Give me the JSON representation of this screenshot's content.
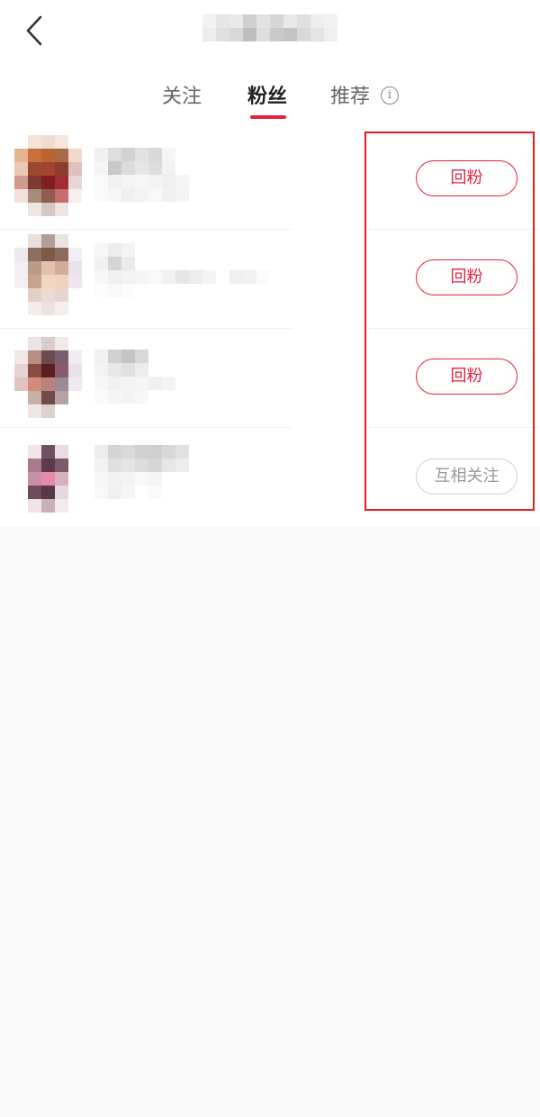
{
  "tabs": [
    {
      "label": "关注",
      "active": false
    },
    {
      "label": "粉丝",
      "active": true
    },
    {
      "label": "推荐",
      "active": false
    }
  ],
  "info_icon": "info-icon",
  "back_icon": "chevron-left-icon",
  "fans": [
    {
      "button": "回粉",
      "button_state": "follow-back"
    },
    {
      "button": "回粉",
      "button_state": "follow-back"
    },
    {
      "button": "回粉",
      "button_state": "follow-back"
    },
    {
      "button": "互相关注",
      "button_state": "mutual"
    }
  ],
  "colors": {
    "accent": "#e5223f",
    "highlight_box": "#e31b23",
    "mutual_border": "#cfcfcf",
    "page_bg": "#f8f8f8"
  }
}
